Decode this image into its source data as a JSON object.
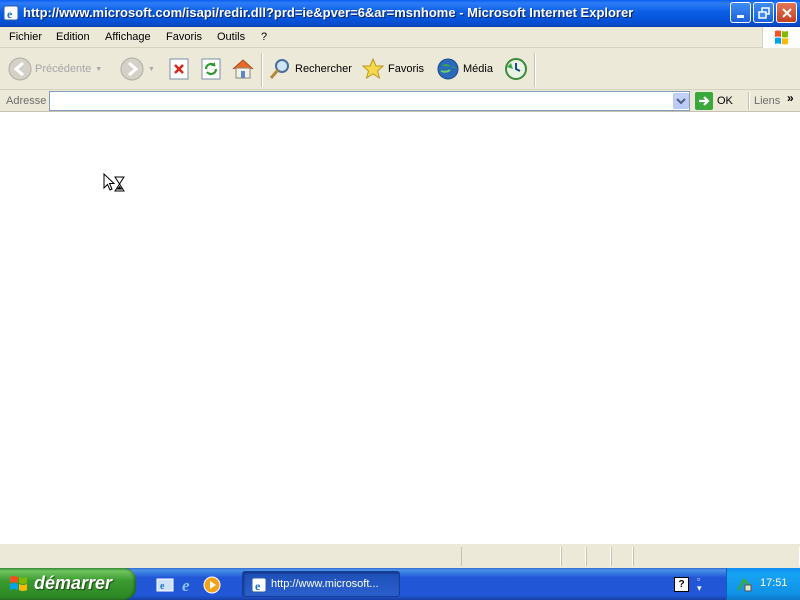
{
  "window": {
    "title": "http://www.microsoft.com/isapi/redir.dll?prd=ie&pver=6&ar=msnhome - Microsoft Internet Explorer"
  },
  "menu": {
    "items": [
      "Fichier",
      "Edition",
      "Affichage",
      "Favoris",
      "Outils",
      "?"
    ]
  },
  "toolbar": {
    "back_label": "Précédente",
    "search_label": "Rechercher",
    "favorites_label": "Favoris",
    "media_label": "Média"
  },
  "address": {
    "label": "Adresse",
    "value": "",
    "go_label": "OK",
    "links_label": "Liens",
    "chevron": "»"
  },
  "statusbar": {
    "text": ""
  },
  "taskbar": {
    "start_label": "démarrer",
    "task_label": "http://www.microsoft...",
    "clock": "17:51"
  },
  "colors": {
    "titlebar": "#0552d7",
    "chrome": "#ece9d8",
    "taskbar": "#2157d7",
    "start": "#3a9a2f",
    "tray": "#1192e6"
  },
  "icons": {
    "app": "ie-icon",
    "back": "back-arrow-icon",
    "forward": "forward-arrow-icon",
    "stop": "stop-icon",
    "refresh": "refresh-icon",
    "home": "home-icon",
    "search": "search-icon",
    "favorites": "star-icon",
    "media": "media-icon",
    "history": "history-icon"
  }
}
